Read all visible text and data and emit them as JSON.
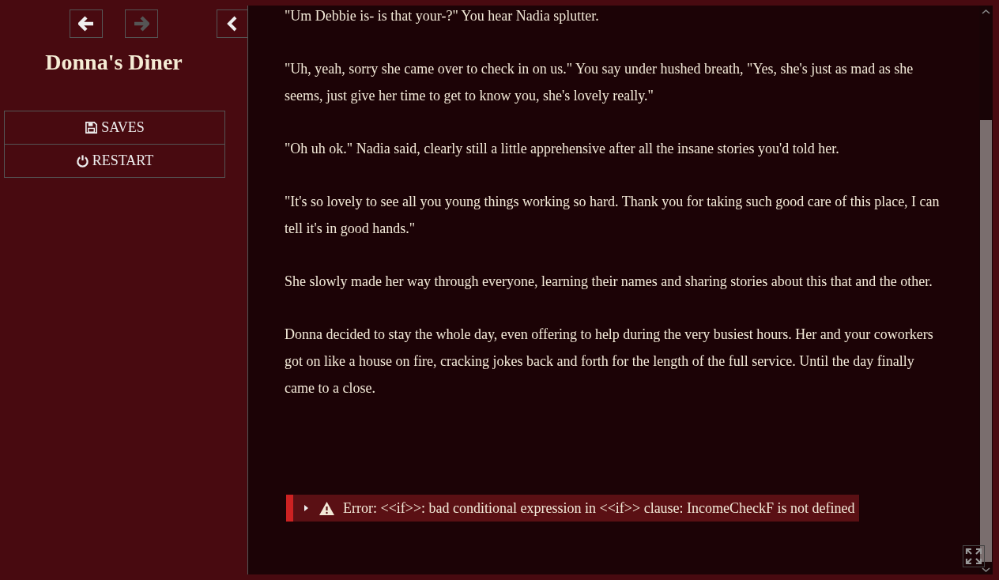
{
  "sidebar": {
    "history": [
      {
        "kind": "back",
        "disabled": false
      },
      {
        "kind": "forward",
        "disabled": true
      }
    ],
    "title": "Donna's Diner",
    "menu": [
      {
        "kind": "saves",
        "label": "SAVES"
      },
      {
        "kind": "restart",
        "label": "RESTART"
      }
    ]
  },
  "passage": {
    "paragraphs": [
      "\"Um Debbie is- is that your-?\" You hear Nadia splutter.",
      "\"Uh, yeah, sorry she came over to check in on us.\" You say under hushed breath, \"Yes, she's just as mad as she seems, just give her time to get to know you, she's lovely really.\"",
      "\"Oh uh ok.\" Nadia said, clearly still a little apprehensive after all the insane stories you'd told her.",
      "\"It's so lovely to see all you young things working so hard. Thank you for taking such good care of this place, I can tell it's in good hands.\"",
      "She slowly made her way through everyone, learning their names and sharing stories about this that and the other.",
      "Donna decided to stay the whole day, even offering to help during the very busiest hours. Her and your coworkers got on like a house on fire, cracking jokes back and forth for the length of the full service. Until the day finally came to a close."
    ],
    "error": {
      "expanded": false,
      "message": "Error: <<if>>: bad conditional expression in <<if>> clause: IncomeCheckF is not defined"
    }
  }
}
